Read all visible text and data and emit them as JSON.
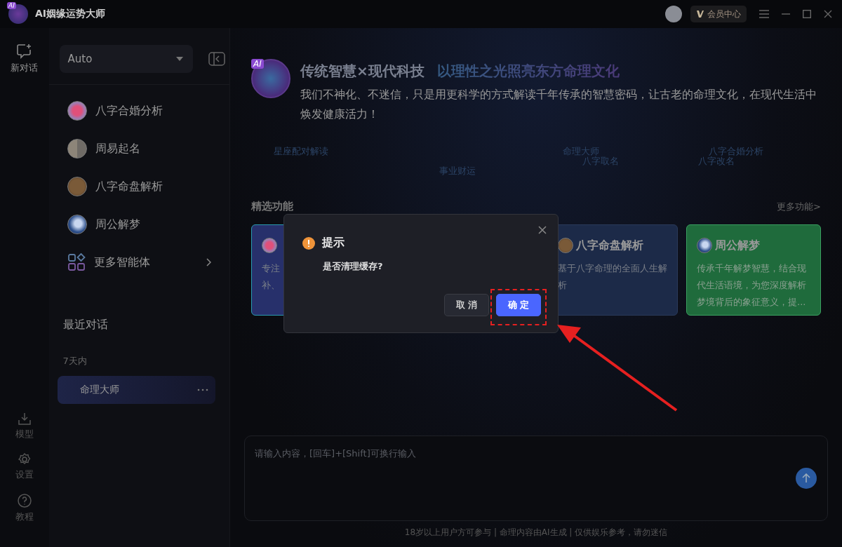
{
  "app": {
    "title": "AI姻缘运势大师",
    "logo_badge": "AI"
  },
  "header": {
    "vip_label": "会员中心"
  },
  "rail": {
    "top": [
      {
        "label": "新对话",
        "kind": "chat"
      }
    ],
    "bottom": [
      {
        "label": "模型",
        "kind": "download"
      },
      {
        "label": "设置",
        "kind": "settings"
      },
      {
        "label": "教程",
        "kind": "help"
      }
    ]
  },
  "sidebar": {
    "model_select": "Auto",
    "agents": [
      {
        "label": "八字合婚分析",
        "kind": "heart"
      },
      {
        "label": "周易起名",
        "kind": "stone"
      },
      {
        "label": "八字命盘解析",
        "kind": "bronze"
      },
      {
        "label": "周公解梦",
        "kind": "moon"
      },
      {
        "label": "更多智能体",
        "kind": "grid"
      }
    ],
    "recent_title": "最近对话",
    "groups": [
      {
        "label": "7天内",
        "items": [
          {
            "title": "命理大师",
            "selected": true
          }
        ]
      }
    ]
  },
  "hero": {
    "logo_badge": "AI",
    "title_lead": "传统智慧×现代科技",
    "title_tail": "以理性之光照亮东方命理文化",
    "subtitle": "我们不神化、不迷信，只是用更科学的方式解读千年传承的智慧密码，让古老的命理文化，在现代生活中焕发健康活力！",
    "tags": [
      "星座配对解读",
      "事业财运",
      "命理大师",
      "八字取名",
      "八字合婚分析",
      "八字改名"
    ]
  },
  "featured": {
    "title": "精选功能",
    "more_link": "更多功能>",
    "cards": [
      {
        "kind": "heart",
        "lines": [
          "专注",
          "补、"
        ],
        "color": "#27306b"
      },
      {
        "kind": "bronze",
        "title": "八字命盘解析",
        "lines": [
          "基于八字命理的全面人生解",
          "析"
        ],
        "color": "#1c2a48"
      },
      {
        "kind": "moon",
        "title": "周公解梦",
        "lines": [
          "传承千年解梦智慧，结合现",
          "代生活语境，为您深度解析",
          "梦境背后的象征意义，提..."
        ],
        "color": "#1f6b3c"
      }
    ]
  },
  "input": {
    "placeholder": "请输入内容，[回车]+[Shift]可换行输入"
  },
  "footer": {
    "disclaimer": "18岁以上用户方可参与 | 命理内容由AI生成 | 仅供娱乐参考，请勿迷信"
  },
  "dialog": {
    "title": "提示",
    "message": "是否清理缓存?",
    "buttons": [
      {
        "label": "取 消",
        "kind": "cancel"
      },
      {
        "label": "确 定",
        "kind": "primary"
      }
    ]
  }
}
